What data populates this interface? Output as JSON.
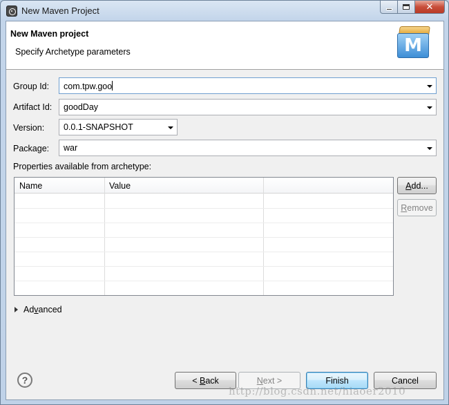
{
  "window": {
    "title": "New Maven Project"
  },
  "banner": {
    "title": "New Maven project",
    "subtitle": "Specify Archetype parameters",
    "logo_letter": "M"
  },
  "form": {
    "group_id": {
      "label": "Group Id:",
      "value": "com.tpw.goo"
    },
    "artifact_id": {
      "label": "Artifact Id:",
      "value": "goodDay"
    },
    "version": {
      "label": "Version:",
      "value": "0.0.1-SNAPSHOT"
    },
    "package": {
      "label": "Package:",
      "value": "war"
    }
  },
  "properties": {
    "label": "Properties available from archetype:",
    "columns": [
      "Name",
      "Value"
    ],
    "rows": [],
    "add_button": {
      "prefix": "",
      "mnemonic": "A",
      "suffix": "dd..."
    },
    "remove_button": {
      "prefix": "",
      "mnemonic": "R",
      "suffix": "emove"
    }
  },
  "advanced": {
    "label_prefix": "Ad",
    "mnemonic": "v",
    "label_suffix": "anced"
  },
  "footer": {
    "help_glyph": "?",
    "back": {
      "prefix": "< ",
      "mnemonic": "B",
      "suffix": "ack"
    },
    "next": {
      "prefix": "",
      "mnemonic": "N",
      "suffix": "ext >"
    },
    "finish": "Finish",
    "cancel": "Cancel"
  },
  "watermark": "http://blog.csdn.net/hiaoer2010"
}
